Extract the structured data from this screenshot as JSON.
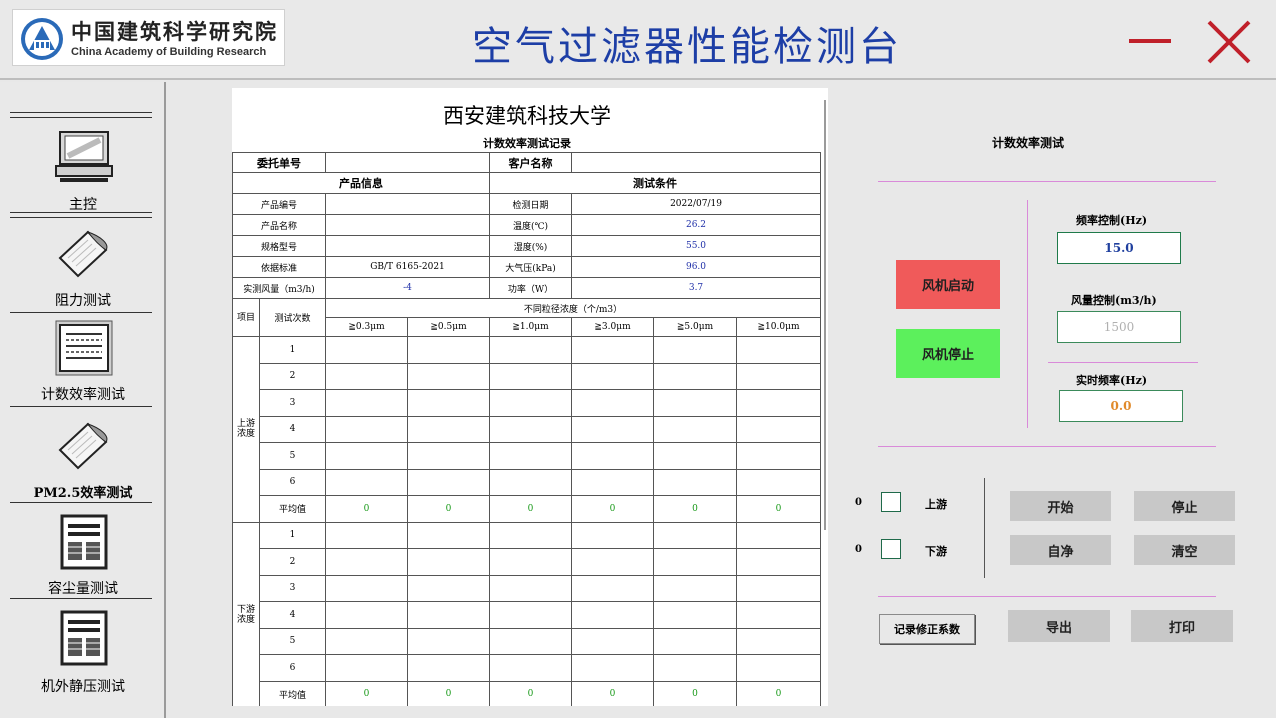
{
  "header": {
    "logo_cn": "中国建筑科学研究院",
    "logo_en": "China Academy of Building Research",
    "title": "空气过滤器性能检测台",
    "min_icon": "minimize-icon",
    "close_icon": "close-icon",
    "accent_color": "#1d3ea6",
    "window_button_color": "#c0202a"
  },
  "sidebar": {
    "items": [
      {
        "label": "主控",
        "icon": "computer-icon"
      },
      {
        "label": "阻力测试",
        "icon": "document-curl-icon"
      },
      {
        "label": "计数效率测试",
        "icon": "report-icon"
      },
      {
        "label": "PM2.5效率测试",
        "icon": "document-curl-icon"
      },
      {
        "label": "容尘量测试",
        "icon": "newspaper-icon"
      },
      {
        "label": "机外静压测试",
        "icon": "newspaper-icon"
      }
    ]
  },
  "report": {
    "title": "西安建筑科技大学",
    "subtitle": "计数效率测试记录",
    "client_no_label": "委托单号",
    "client_no": "",
    "customer_label": "客户名称",
    "customer": "",
    "product_info": "产品信息",
    "test_conditions": "测试条件",
    "rows_info": [
      {
        "k1": "产品编号",
        "v1": "",
        "k2": "检测日期",
        "v2": "2022/07/19"
      },
      {
        "k1": "产品名称",
        "v1": "",
        "k2": "温度(℃)",
        "v2": "26.2"
      },
      {
        "k1": "规格型号",
        "v1": "",
        "k2": "湿度(%)",
        "v2": "55.0"
      },
      {
        "k1": "依据标准",
        "v1": "GB/T 6165-2021",
        "k2": "大气压(kPa)",
        "v2": "96.0"
      },
      {
        "k1": "实测风量（m3/h)",
        "v1": "-4",
        "k2": "功率（W）",
        "v2": "3.7"
      }
    ],
    "item_label": "项目",
    "count_label": "测试次数",
    "size_header": "不同粒径浓度（个/m3）",
    "sizes": [
      "≧0.3μm",
      "≧0.5μm",
      "≧1.0μm",
      "≧3.0μm",
      "≧5.0μm",
      "≧10.0μm"
    ],
    "upstream_label": "上游浓度",
    "downstream_label": "下游浓度",
    "run_numbers": [
      "1",
      "2",
      "3",
      "4",
      "5",
      "6"
    ],
    "avg_label": "平均值",
    "avg_values": [
      "0",
      "0",
      "0",
      "0",
      "0",
      "0"
    ],
    "value_color": "#1a9a1a"
  },
  "panel": {
    "title": "计数效率测试",
    "fan_start": "风机启动",
    "fan_stop": "风机停止",
    "freq_label": "频率控制(Hz)",
    "freq_value": "15.0",
    "airflow_label": "风量控制(m3/h)",
    "airflow_value": "1500",
    "realfreq_label": "实时频率(Hz)",
    "realfreq_value": "0.0",
    "upstream": {
      "count": "0",
      "label": "上游"
    },
    "downstream": {
      "count": "0",
      "label": "下游"
    },
    "start": "开始",
    "stop": "停止",
    "self_clean": "自净",
    "clear": "清空",
    "record_coef": "记录修正系数",
    "export": "导出",
    "print": "打印",
    "fan_start_color": "#f05a5a",
    "fan_stop_color": "#5cf05c"
  }
}
